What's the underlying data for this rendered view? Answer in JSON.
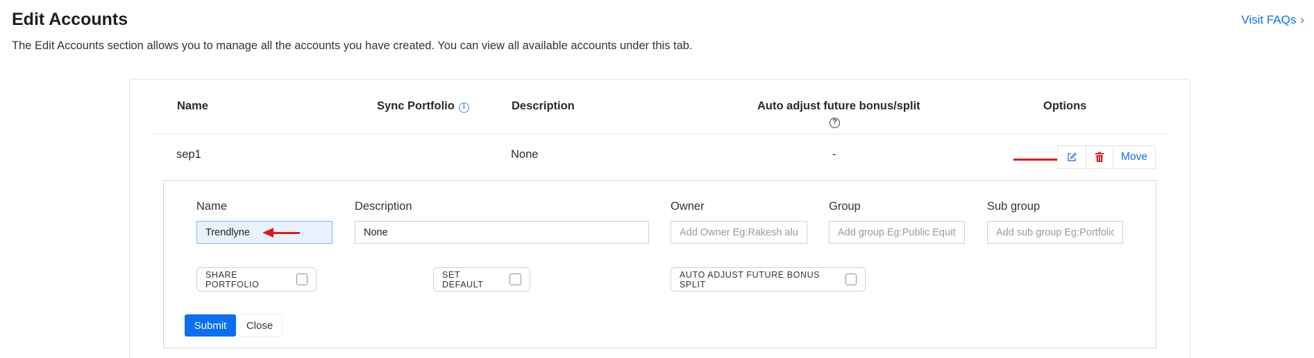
{
  "header": {
    "title": "Edit Accounts",
    "description": "The Edit Accounts section allows you to manage all the accounts you have created. You can view all available accounts under this tab.",
    "faq_link": "Visit FAQs",
    "faq_chevron": "›"
  },
  "table": {
    "columns": {
      "name": "Name",
      "sync": "Sync Portfolio",
      "description": "Description",
      "auto_adjust": "Auto adjust future bonus/split",
      "options": "Options"
    },
    "rows": [
      {
        "name": "sep1",
        "description": "None",
        "auto_adjust": "-"
      }
    ],
    "move_label": "Move"
  },
  "edit_form": {
    "name_label": "Name",
    "name_value": "Trendlyne",
    "description_label": "Description",
    "description_value": "None",
    "owner_label": "Owner",
    "owner_placeholder": "Add Owner Eg:Rakesh aluwalia",
    "group_label": "Group",
    "group_placeholder": "Add group Eg:Public Equity",
    "subgroup_label": "Sub group",
    "subgroup_placeholder": "Add sub group Eg:Portfolio",
    "share_label": "SHARE PORTFOLIO",
    "default_label": "SET DEFAULT",
    "auto_adjust_label": "AUTO ADJUST FUTURE BONUS SPLIT",
    "submit_label": "Submit",
    "close_label": "Close"
  },
  "colors": {
    "accent": "#0b6ff2",
    "danger": "#e02020",
    "annotation_arrow": "#e01a1a"
  }
}
